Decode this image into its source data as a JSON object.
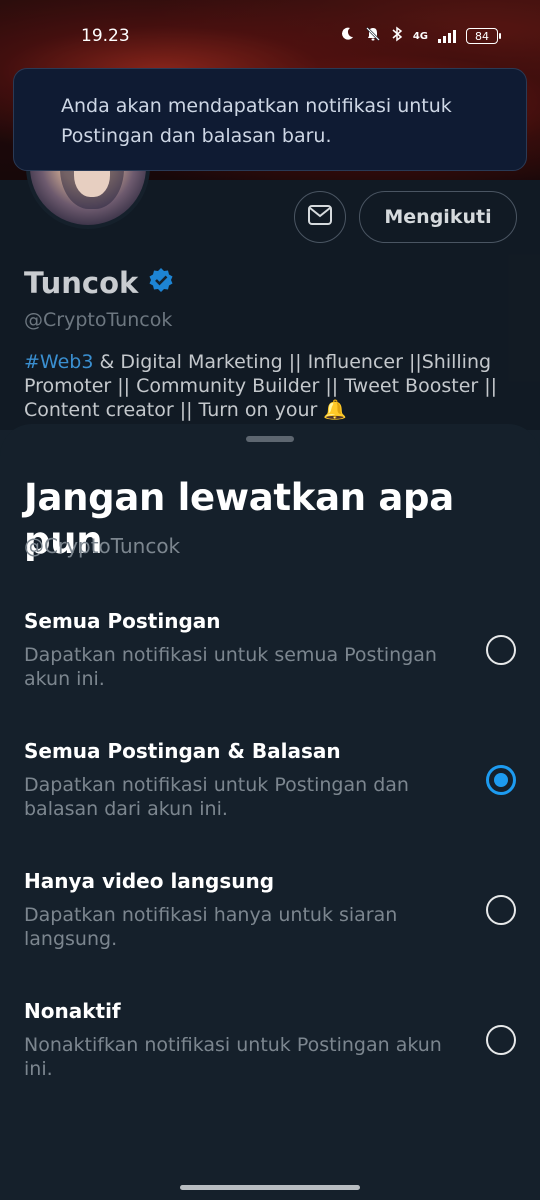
{
  "status_bar": {
    "time": "19.23",
    "network": "4G",
    "battery": "84"
  },
  "toast": {
    "message": "Anda akan mendapatkan notifikasi untuk Postingan dan balasan baru."
  },
  "profile": {
    "follow_label": "Mengikuti",
    "name": "Tuncok",
    "handle": "@CryptoTuncok",
    "bio_tag": "#Web3",
    "bio_rest": " & Digital Marketing || Influencer ||Shilling Promoter || Community Builder ||  Tweet Booster || Content creator || Turn on your 🔔"
  },
  "sheet": {
    "title": "Jangan lewatkan apa pun",
    "subtitle": "@CryptoTuncok",
    "options": [
      {
        "title": "Semua Postingan",
        "desc": "Dapatkan notifikasi untuk semua Postingan akun ini.",
        "selected": false
      },
      {
        "title": "Semua Postingan & Balasan",
        "desc": "Dapatkan notifikasi untuk Postingan dan balasan dari akun ini.",
        "selected": true
      },
      {
        "title": "Hanya video langsung",
        "desc": "Dapatkan notifikasi hanya untuk siaran langsung.",
        "selected": false
      },
      {
        "title": "Nonaktif",
        "desc": "Nonaktifkan notifikasi untuk Postingan akun ini.",
        "selected": false
      }
    ]
  },
  "colors": {
    "accent": "#1d9bf0",
    "background": "#15202b",
    "hashtag": "#3a8fd0"
  },
  "icons": [
    "moon-icon",
    "mute-bell-icon",
    "bluetooth-icon",
    "signal-icon",
    "battery-icon",
    "mail-icon",
    "verified-badge-icon",
    "bell-emoji"
  ]
}
